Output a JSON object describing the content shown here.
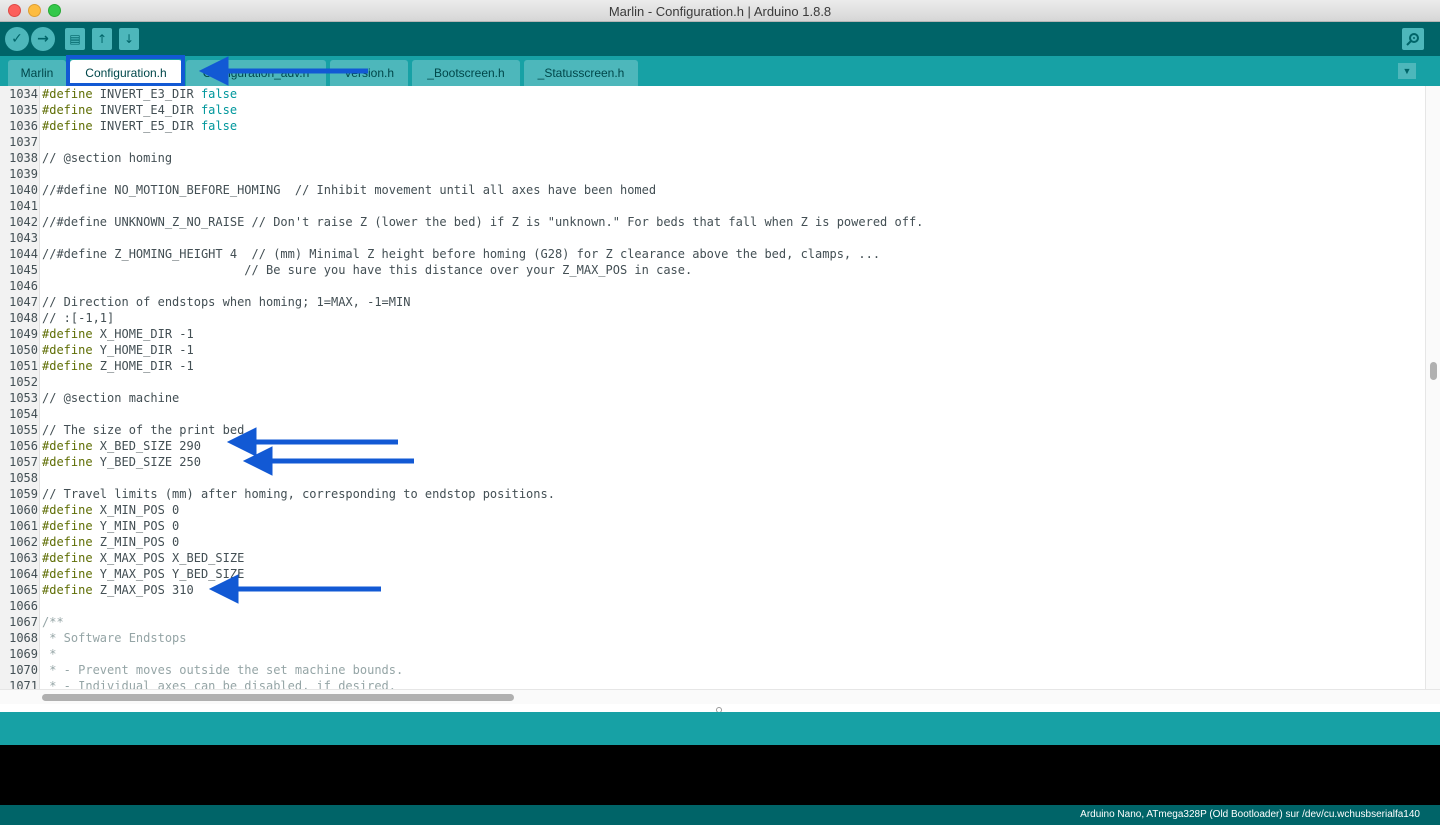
{
  "window": {
    "title": "Marlin - Configuration.h | Arduino 1.8.8"
  },
  "toolbar": {
    "buttons": [
      {
        "name": "verify-button",
        "glyph": "✓"
      },
      {
        "name": "upload-button",
        "glyph": "→"
      },
      {
        "name": "new-button",
        "glyph": "▤"
      },
      {
        "name": "open-button",
        "glyph": "↑"
      },
      {
        "name": "save-button",
        "glyph": "↓"
      }
    ],
    "serial_monitor_icon": "magnifier-icon"
  },
  "tabs": [
    {
      "label": "Marlin",
      "active": false
    },
    {
      "label": "Configuration.h",
      "active": true
    },
    {
      "label": "Configuration_adv.h",
      "active": false
    },
    {
      "label": "Version.h",
      "active": false
    },
    {
      "label": "_Bootscreen.h",
      "active": false
    },
    {
      "label": "_Statusscreen.h",
      "active": false
    }
  ],
  "editor": {
    "lines": [
      {
        "n": "1034",
        "parts": [
          [
            "kw",
            "#define"
          ],
          [
            "t",
            " INVERT_E3_DIR "
          ],
          [
            "lit",
            "false"
          ]
        ]
      },
      {
        "n": "1035",
        "parts": [
          [
            "kw",
            "#define"
          ],
          [
            "t",
            " INVERT_E4_DIR "
          ],
          [
            "lit",
            "false"
          ]
        ]
      },
      {
        "n": "1036",
        "parts": [
          [
            "kw",
            "#define"
          ],
          [
            "t",
            " INVERT_E5_DIR "
          ],
          [
            "lit",
            "false"
          ]
        ]
      },
      {
        "n": "1037",
        "parts": []
      },
      {
        "n": "1038",
        "parts": [
          [
            "cmt",
            "// @section homing"
          ]
        ]
      },
      {
        "n": "1039",
        "parts": []
      },
      {
        "n": "1040",
        "parts": [
          [
            "cmt",
            "//#define NO_MOTION_BEFORE_HOMING  // Inhibit movement until all axes have been homed"
          ]
        ]
      },
      {
        "n": "1041",
        "parts": []
      },
      {
        "n": "1042",
        "parts": [
          [
            "cmt",
            "//#define UNKNOWN_Z_NO_RAISE // Don't raise Z (lower the bed) if Z is \"unknown.\" For beds that fall when Z is powered off."
          ]
        ]
      },
      {
        "n": "1043",
        "parts": []
      },
      {
        "n": "1044",
        "parts": [
          [
            "cmt",
            "//#define Z_HOMING_HEIGHT 4  // (mm) Minimal Z height before homing (G28) for Z clearance above the bed, clamps, ..."
          ]
        ]
      },
      {
        "n": "1045",
        "parts": [
          [
            "cmt",
            "                            // Be sure you have this distance over your Z_MAX_POS in case."
          ]
        ]
      },
      {
        "n": "1046",
        "parts": []
      },
      {
        "n": "1047",
        "parts": [
          [
            "cmt",
            "// Direction of endstops when homing; 1=MAX, -1=MIN"
          ]
        ]
      },
      {
        "n": "1048",
        "parts": [
          [
            "cmt",
            "// :[-1,1]"
          ]
        ]
      },
      {
        "n": "1049",
        "parts": [
          [
            "kw",
            "#define"
          ],
          [
            "t",
            " X_HOME_DIR -1"
          ]
        ]
      },
      {
        "n": "1050",
        "parts": [
          [
            "kw",
            "#define"
          ],
          [
            "t",
            " Y_HOME_DIR -1"
          ]
        ]
      },
      {
        "n": "1051",
        "parts": [
          [
            "kw",
            "#define"
          ],
          [
            "t",
            " Z_HOME_DIR -1"
          ]
        ]
      },
      {
        "n": "1052",
        "parts": []
      },
      {
        "n": "1053",
        "parts": [
          [
            "cmt",
            "// @section machine"
          ]
        ]
      },
      {
        "n": "1054",
        "parts": []
      },
      {
        "n": "1055",
        "parts": [
          [
            "cmt",
            "// The size of the print bed"
          ]
        ]
      },
      {
        "n": "1056",
        "parts": [
          [
            "kw",
            "#define"
          ],
          [
            "t",
            " X_BED_SIZE 290"
          ]
        ]
      },
      {
        "n": "1057",
        "parts": [
          [
            "kw",
            "#define"
          ],
          [
            "t",
            " Y_BED_SIZE 250"
          ]
        ]
      },
      {
        "n": "1058",
        "parts": []
      },
      {
        "n": "1059",
        "parts": [
          [
            "cmt",
            "// Travel limits (mm) after homing, corresponding to endstop positions."
          ]
        ]
      },
      {
        "n": "1060",
        "parts": [
          [
            "kw",
            "#define"
          ],
          [
            "t",
            " X_MIN_POS 0"
          ]
        ]
      },
      {
        "n": "1061",
        "parts": [
          [
            "kw",
            "#define"
          ],
          [
            "t",
            " Y_MIN_POS 0"
          ]
        ]
      },
      {
        "n": "1062",
        "parts": [
          [
            "kw",
            "#define"
          ],
          [
            "t",
            " Z_MIN_POS 0"
          ]
        ]
      },
      {
        "n": "1063",
        "parts": [
          [
            "kw",
            "#define"
          ],
          [
            "t",
            " X_MAX_POS X_BED_SIZE"
          ]
        ]
      },
      {
        "n": "1064",
        "parts": [
          [
            "kw",
            "#define"
          ],
          [
            "t",
            " Y_MAX_POS Y_BED_SIZE"
          ]
        ]
      },
      {
        "n": "1065",
        "parts": [
          [
            "kw",
            "#define"
          ],
          [
            "t",
            " Z_MAX_POS 310"
          ]
        ]
      },
      {
        "n": "1066",
        "parts": []
      },
      {
        "n": "1067",
        "parts": [
          [
            "doc",
            "/**"
          ]
        ]
      },
      {
        "n": "1068",
        "parts": [
          [
            "doc",
            " * Software Endstops"
          ]
        ]
      },
      {
        "n": "1069",
        "parts": [
          [
            "doc",
            " *"
          ]
        ]
      },
      {
        "n": "1070",
        "parts": [
          [
            "doc",
            " * - Prevent moves outside the set machine bounds."
          ]
        ]
      },
      {
        "n": "1071",
        "parts": [
          [
            "doc",
            " * - Individual axes can be disabled, if desired."
          ]
        ]
      }
    ]
  },
  "status_bar": {
    "board_port": "Arduino Nano, ATmega328P (Old Bootloader) sur /dev/cu.wchusbserialfa140"
  },
  "annotation": {
    "arrow_color": "#1259d4"
  }
}
